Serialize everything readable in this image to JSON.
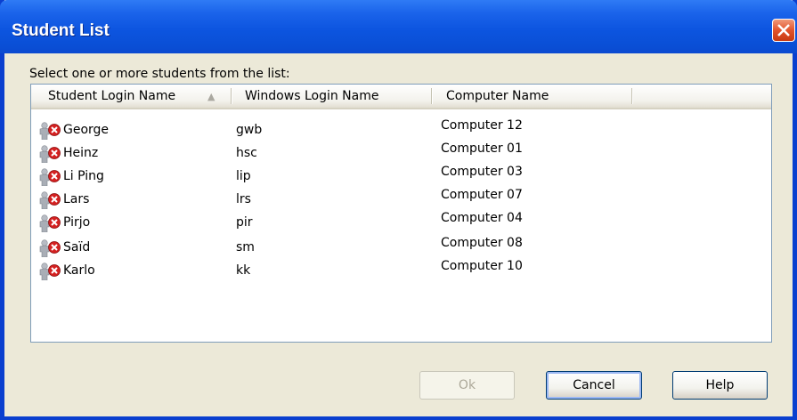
{
  "window": {
    "title": "Student List"
  },
  "prompt": "Select one or more students from the list:",
  "columns": [
    "Student Login Name",
    "Windows Login Name",
    "Computer Name"
  ],
  "sort_indicator": "▲",
  "rows": [
    {
      "student": "George",
      "windows": "gwb",
      "computer": "Computer 12"
    },
    {
      "student": "Heinz",
      "windows": "hsc",
      "computer": "Computer 01"
    },
    {
      "student": "Li Ping",
      "windows": "lip",
      "computer": "Computer 03"
    },
    {
      "student": "Lars",
      "windows": "lrs",
      "computer": "Computer 07"
    },
    {
      "student": "Pirjo",
      "windows": "pir",
      "computer": "Computer 04"
    },
    {
      "student": "Saïd",
      "windows": "sm",
      "computer": "Computer 08"
    },
    {
      "student": "Karlo",
      "windows": "kk",
      "computer": "Computer 10"
    }
  ],
  "buttons": {
    "ok": "Ok",
    "cancel": "Cancel",
    "help": "Help"
  },
  "colors": {
    "titlebar": "#0a4fd6",
    "close": "#e2532c",
    "disconnected": "#d42020"
  }
}
